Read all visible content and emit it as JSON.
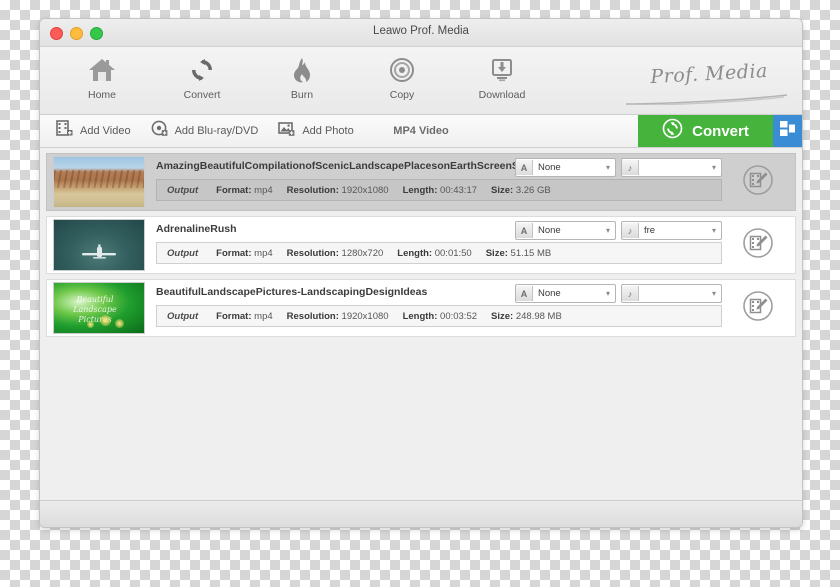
{
  "window": {
    "title": "Leawo Prof. Media",
    "traffic_lights": [
      "close",
      "minimize",
      "maximize"
    ]
  },
  "nav": {
    "items": [
      {
        "label": "Home",
        "icon": "home-icon"
      },
      {
        "label": "Convert",
        "icon": "convert-arrows-icon"
      },
      {
        "label": "Burn",
        "icon": "flame-icon"
      },
      {
        "label": "Copy",
        "icon": "disc-icon"
      },
      {
        "label": "Download",
        "icon": "download-monitor-icon"
      }
    ],
    "brand": "Prof. Media"
  },
  "addbar": {
    "buttons": [
      {
        "label": "Add Video",
        "icon": "film-plus-icon"
      },
      {
        "label": "Add Blu-ray/DVD",
        "icon": "disc-plus-icon"
      },
      {
        "label": "Add Photo",
        "icon": "photo-plus-icon"
      }
    ],
    "profile": "MP4 Video",
    "convert_label": "Convert",
    "convert_icon": "refresh-circle-icon",
    "panel_icon": "panel-layout-icon",
    "colors": {
      "convert_green": "#46b43c",
      "panel_blue": "#3a8dd4"
    }
  },
  "list": {
    "labels": {
      "output": "Output",
      "format": "Format:",
      "resolution": "Resolution:",
      "length": "Length:",
      "size": "Size:"
    },
    "rows": [
      {
        "selected": true,
        "title": "AmazingBeautifulCompilationofScenicLandscapePlacesonEarthScreenSav",
        "format": "mp4",
        "resolution": "1920x1080",
        "length": "00:43:17",
        "size": "3.26 GB",
        "subtitle_value": "None",
        "subtitle_icon": "A",
        "audio_value": "",
        "audio_icon": "music-note-icon",
        "edit_icon": "edit-video-icon",
        "thumbnail": "desert-canyon-landscape"
      },
      {
        "selected": false,
        "title": "AdrenalineRush",
        "format": "mp4",
        "resolution": "1280x720",
        "length": "00:01:50",
        "size": "51.15 MB",
        "subtitle_value": "None",
        "subtitle_icon": "A",
        "audio_value": "fre",
        "audio_icon": "music-note-icon",
        "edit_icon": "edit-video-icon",
        "thumbnail": "airplane-in-sky"
      },
      {
        "selected": false,
        "title": "BeautifulLandscapePictures-LandscapingDesignIdeas",
        "format": "mp4",
        "resolution": "1920x1080",
        "length": "00:03:52",
        "size": "248.98 MB",
        "subtitle_value": "None",
        "subtitle_icon": "A",
        "audio_value": "",
        "audio_icon": "music-note-icon",
        "edit_icon": "edit-video-icon",
        "thumbnail": "green-landscape-title-card",
        "thumbnail_text": "Beautiful Landscape Pictures"
      }
    ]
  }
}
